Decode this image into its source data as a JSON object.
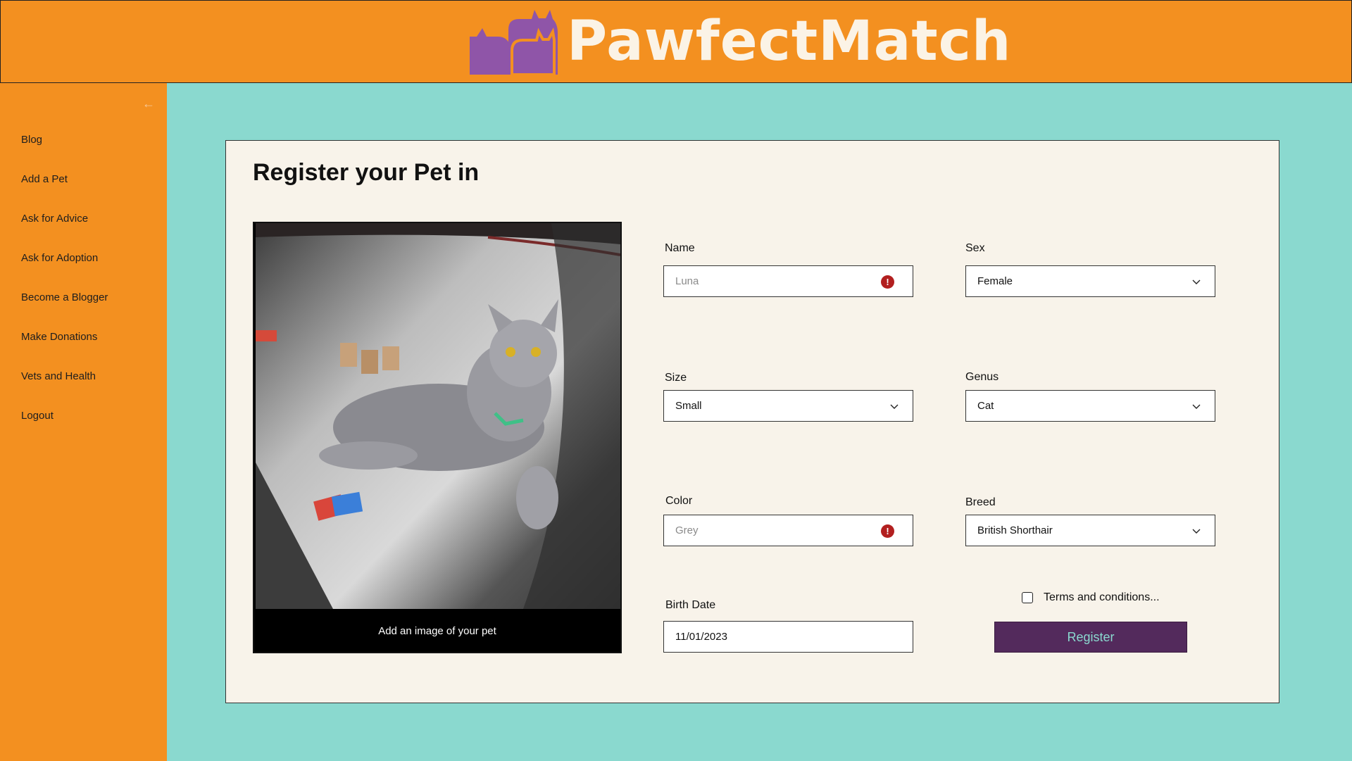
{
  "header": {
    "brand": "PawfectMatch",
    "colors": {
      "bar": "#f39020",
      "logo_icon": "#8f55a8",
      "logo_text": "#fbf3e6"
    }
  },
  "sidebar": {
    "collapse_icon": "arrow-left-icon",
    "items": [
      {
        "label": "Blog"
      },
      {
        "label": "Add a Pet"
      },
      {
        "label": "Ask for Advice"
      },
      {
        "label": "Ask for Adoption"
      },
      {
        "label": "Become a Blogger"
      },
      {
        "label": "Make Donations"
      },
      {
        "label": "Vets and Health"
      },
      {
        "label": "Logout"
      }
    ]
  },
  "form": {
    "title": "Register your Pet in",
    "photo_caption": "Add an image of your pet",
    "name": {
      "label": "Name",
      "placeholder": "Luna"
    },
    "sex": {
      "label": "Sex",
      "value": "Female"
    },
    "size": {
      "label": "Size",
      "value": "Small"
    },
    "genus": {
      "label": "Genus",
      "value": "Cat"
    },
    "color": {
      "label": "Color",
      "placeholder": "Grey"
    },
    "breed": {
      "label": "Breed",
      "value": "British Shorthair"
    },
    "birth_date": {
      "label": "Birth Date",
      "value": "11/01/2023"
    },
    "terms": {
      "label": "Terms and conditions...",
      "checked": false
    },
    "register_label": "Register",
    "colors": {
      "error": "#b21f1f",
      "button": "#532a5c",
      "button_text": "#8ad9cf",
      "background": "#8ad9cf"
    }
  }
}
